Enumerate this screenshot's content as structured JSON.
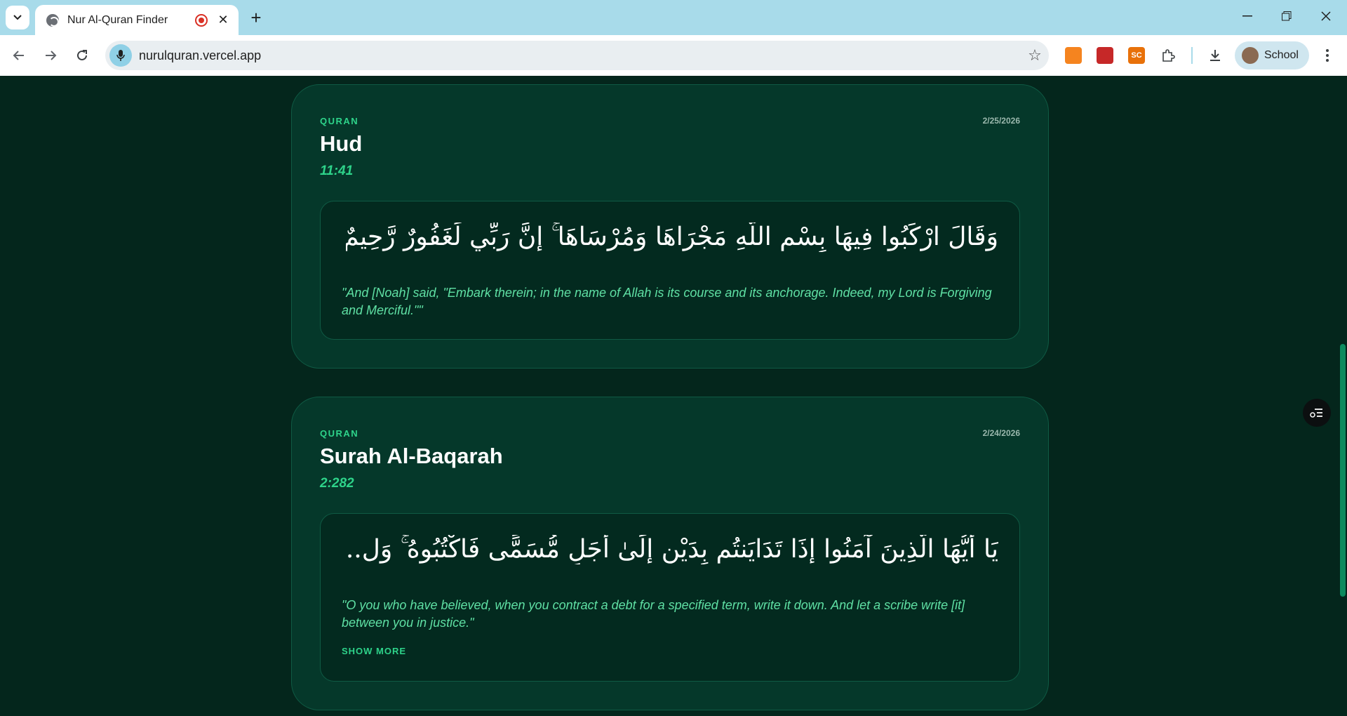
{
  "browser": {
    "tab_title": "Nur Al-Quran Finder",
    "url": "nurulquran.vercel.app",
    "profile_name": "School",
    "extensions": [
      {
        "name": "metamask-icon",
        "color": "#f5841f",
        "label": ""
      },
      {
        "name": "red-extension-icon",
        "color": "#c62828",
        "label": ""
      },
      {
        "name": "sc-extension-icon",
        "color": "#e8710a",
        "label": "SC"
      },
      {
        "name": "puzzle-icon",
        "color": "#3c4043",
        "label": ""
      }
    ]
  },
  "cards": [
    {
      "source": "QURAN",
      "date": "2/25/2026",
      "title": "Hud",
      "reference": "11:41",
      "arabic": "وَقَالَ ارْكَبُوا فِيهَا بِسْمِ اللَّهِ مَجْرَاهَا وَمُرْسَاهَا ۚ إِنَّ رَبِّي لَغَفُورٌ رَّحِيمٌ",
      "translation": "\"And [Noah] said, \"Embark therein; in the name of Allah is its course and its anchorage. Indeed, my Lord is Forgiving and Merciful.\"\""
    },
    {
      "source": "QURAN",
      "date": "2/24/2026",
      "title": "Surah Al-Baqarah",
      "reference": "2:282",
      "arabic": "يَا أَيُّهَا الَّذِينَ آمَنُوا إِذَا تَدَايَنتُم بِدَيْنٍ إِلَىٰ أَجَلٍ مُّسَمًّى فَاكْتُبُوهُ ۚ وَل...",
      "translation": "\"O you who have believed, when you contract a debt for a specified term, write it down. And let a scribe write [it] between you in justice.\"",
      "show_more_label": "SHOW MORE"
    }
  ],
  "colors": {
    "background": "#04261c",
    "card": "#05382a",
    "accent": "#2ed38a",
    "tabbar": "#a8dbea"
  }
}
